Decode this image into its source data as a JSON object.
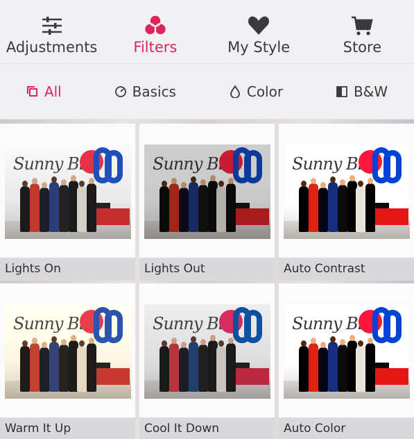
{
  "tabs": [
    {
      "label": "Adjustments",
      "icon": "sliders-icon",
      "active": false
    },
    {
      "label": "Filters",
      "icon": "three-circles-icon",
      "active": true
    },
    {
      "label": "My Style",
      "icon": "heart-icon",
      "active": false
    },
    {
      "label": "Store",
      "icon": "cart-icon",
      "active": false
    }
  ],
  "segments": [
    {
      "label": "All",
      "icon": "layers-icon",
      "active": true
    },
    {
      "label": "Basics",
      "icon": "dial-icon",
      "active": false
    },
    {
      "label": "Color",
      "icon": "drop-icon",
      "active": false
    },
    {
      "label": "B&W",
      "icon": "half-square-icon",
      "active": false
    }
  ],
  "filters": [
    {
      "name": "Lights On",
      "photo_text": "Sunny Bird"
    },
    {
      "name": "Lights Out",
      "photo_text": "Sunny Bird"
    },
    {
      "name": "Auto Contrast",
      "photo_text": "Sunny Bird"
    },
    {
      "name": "Warm It Up",
      "photo_text": "Sunny Bird"
    },
    {
      "name": "Cool It Down",
      "photo_text": "Sunny Bird"
    },
    {
      "name": "Auto Color",
      "photo_text": "Sunny Bird"
    }
  ],
  "colors": {
    "accent": "#e0245b",
    "text": "#3a3a3c",
    "caption_bg": "#d9d9dc"
  }
}
